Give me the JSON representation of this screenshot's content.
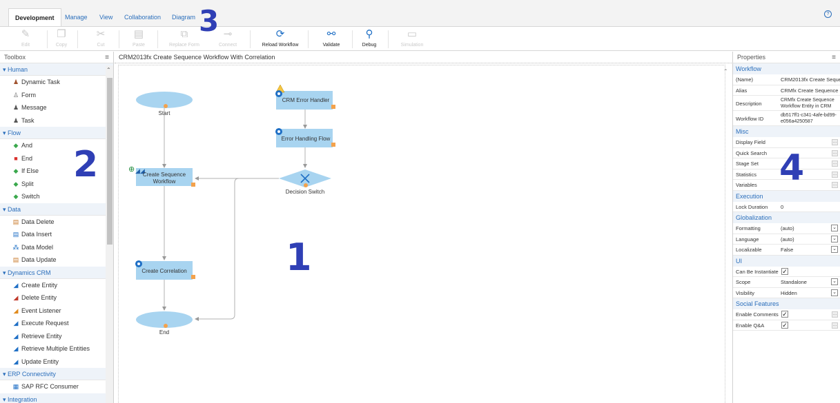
{
  "ribbon": {
    "tabs": [
      "Development",
      "Manage",
      "View",
      "Collaboration",
      "Diagram"
    ],
    "active_tab": "Development",
    "help_icon": "help-icon",
    "buttons": [
      {
        "label": "Edit",
        "icon": "pencil-icon",
        "enabled": false
      },
      {
        "label": "Copy",
        "icon": "copy-icon",
        "enabled": false
      },
      {
        "label": "Cut",
        "icon": "scissors-icon",
        "enabled": false
      },
      {
        "label": "Paste",
        "icon": "paste-icon",
        "enabled": false
      },
      {
        "label": "Replace Form",
        "icon": "replace-form-icon",
        "enabled": false
      },
      {
        "label": "Connect",
        "icon": "connect-icon",
        "enabled": false
      },
      {
        "label": "Reload Workflow",
        "icon": "reload-icon",
        "enabled": true
      },
      {
        "label": "Validate",
        "icon": "validate-icon",
        "enabled": true
      },
      {
        "label": "Debug",
        "icon": "debug-icon",
        "enabled": true
      },
      {
        "label": "Simulation",
        "icon": "simulation-icon",
        "enabled": false
      }
    ]
  },
  "callouts": [
    "1",
    "2",
    "3",
    "4"
  ],
  "toolbox": {
    "title": "Toolbox",
    "categories": [
      {
        "name": "Human",
        "items": [
          {
            "label": "Dynamic Task",
            "icon": "user-task-icon"
          },
          {
            "label": "Form",
            "icon": "form-icon"
          },
          {
            "label": "Message",
            "icon": "message-icon"
          },
          {
            "label": "Task",
            "icon": "task-icon"
          }
        ]
      },
      {
        "name": "Flow",
        "items": [
          {
            "label": "And",
            "icon": "and-gate-icon"
          },
          {
            "label": "End",
            "icon": "end-icon"
          },
          {
            "label": "If Else",
            "icon": "if-else-icon"
          },
          {
            "label": "Split",
            "icon": "split-icon"
          },
          {
            "label": "Switch",
            "icon": "switch-icon"
          }
        ]
      },
      {
        "name": "Data",
        "items": [
          {
            "label": "Data Delete",
            "icon": "data-delete-icon"
          },
          {
            "label": "Data Insert",
            "icon": "data-insert-icon"
          },
          {
            "label": "Data Model",
            "icon": "data-model-icon"
          },
          {
            "label": "Data Update",
            "icon": "data-update-icon"
          }
        ]
      },
      {
        "name": "Dynamics CRM",
        "items": [
          {
            "label": "Create Entity",
            "icon": "create-entity-icon"
          },
          {
            "label": "Delete Entity",
            "icon": "delete-entity-icon"
          },
          {
            "label": "Event Listener",
            "icon": "event-listener-icon"
          },
          {
            "label": "Execute Request",
            "icon": "execute-request-icon"
          },
          {
            "label": "Retrieve Entity",
            "icon": "retrieve-entity-icon"
          },
          {
            "label": "Retrieve Multiple Entities",
            "icon": "retrieve-multiple-icon"
          },
          {
            "label": "Update Entity",
            "icon": "update-entity-icon"
          }
        ]
      },
      {
        "name": "ERP Connectivity",
        "items": [
          {
            "label": "SAP RFC Consumer",
            "icon": "sap-rfc-icon"
          }
        ]
      },
      {
        "name": "Integration",
        "items": []
      }
    ]
  },
  "canvas": {
    "title": "CRM2013fx Create Sequence Workflow With Correlation",
    "nodes": {
      "start": "Start",
      "create_sequence": [
        "Create Sequence",
        "Workflow"
      ],
      "create_correlation": "Create Correlation",
      "end": "End",
      "crm_error_handler": "CRM Error Handler",
      "error_handling_flow": "Error Handling Flow",
      "decision_switch": "Decision Switch"
    }
  },
  "properties": {
    "title": "Properties",
    "sections": [
      {
        "name": "Workflow",
        "rows": [
          {
            "key": "(Name)",
            "value": "CRM2013fx Create Seque",
            "kind": "text"
          },
          {
            "key": "Alias",
            "value": "CRMfx Create Sequence",
            "kind": "text"
          },
          {
            "key": "Description",
            "value": "CRMfx Create Sequence Workflow Entity in CRM",
            "kind": "tall"
          },
          {
            "key": "Workflow ID",
            "value": "db517ff1-c341-4afe-bd99-e056a4250587",
            "kind": "tall"
          }
        ]
      },
      {
        "name": "Misc",
        "rows": [
          {
            "key": "Display Field",
            "value": "",
            "kind": "ellipsis"
          },
          {
            "key": "Quick Search",
            "value": "",
            "kind": "ellipsis"
          },
          {
            "key": "Stage Set",
            "value": "",
            "kind": "ellipsis"
          },
          {
            "key": "Statistics",
            "value": "",
            "kind": "ellipsis"
          },
          {
            "key": "Variables",
            "value": "",
            "kind": "ellipsis"
          }
        ]
      },
      {
        "name": "Execution",
        "rows": [
          {
            "key": "Lock Duration",
            "value": "0",
            "kind": "text"
          }
        ]
      },
      {
        "name": "Globalization",
        "rows": [
          {
            "key": "Formatting",
            "value": "(auto)",
            "kind": "select"
          },
          {
            "key": "Language",
            "value": "(auto)",
            "kind": "select"
          },
          {
            "key": "Localizable",
            "value": "False",
            "kind": "select"
          }
        ]
      },
      {
        "name": "UI",
        "rows": [
          {
            "key": "Can Be Instantiated",
            "value": "",
            "kind": "check"
          },
          {
            "key": "Scope",
            "value": "Standalone",
            "kind": "select"
          },
          {
            "key": "Visibility",
            "value": "Hidden",
            "kind": "select"
          }
        ]
      },
      {
        "name": "Social Features",
        "rows": [
          {
            "key": "Enable Comments",
            "value": "",
            "kind": "check-ellipsis"
          },
          {
            "key": "Enable Q&A",
            "value": "",
            "kind": "check-ellipsis"
          }
        ]
      }
    ]
  },
  "colors": {
    "accent": "#2a6ebb",
    "node_fill": "#a8d4f0",
    "callout": "#2f3fb5",
    "category_bg": "#eef3f9"
  }
}
